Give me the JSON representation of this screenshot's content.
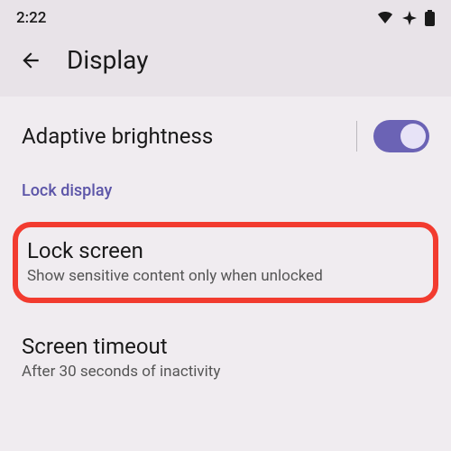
{
  "status": {
    "time": "2:22",
    "icons": {
      "wifi": "wifi-icon",
      "airplane": "airplane-icon",
      "battery": "battery-icon"
    }
  },
  "header": {
    "title": "Display",
    "back": "back-arrow-icon"
  },
  "adaptive": {
    "label": "Adaptive brightness",
    "toggled": true
  },
  "section": {
    "label": "Lock display"
  },
  "lockscreen": {
    "title": "Lock screen",
    "subtitle": "Show sensitive content only when unlocked"
  },
  "timeout": {
    "title": "Screen timeout",
    "subtitle": "After 30 seconds of inactivity"
  },
  "colors": {
    "accent": "#6b63b5",
    "highlight": "#f23b2f"
  }
}
